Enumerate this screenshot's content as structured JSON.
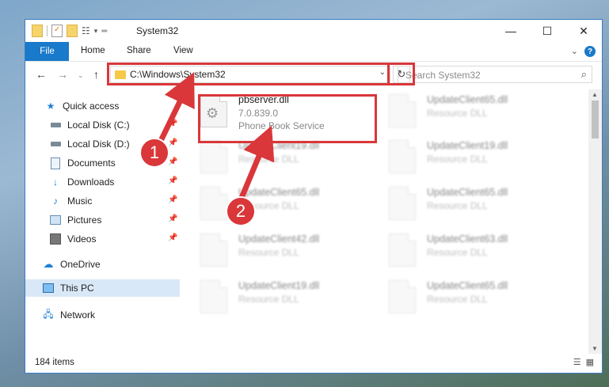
{
  "window": {
    "title": "System32"
  },
  "ribbon": {
    "file_label": "File",
    "tabs": [
      "Home",
      "Share",
      "View"
    ],
    "help_label": "?"
  },
  "address": {
    "path": "C:\\Windows\\System32"
  },
  "search": {
    "placeholder": "Search System32"
  },
  "sidebar": {
    "items": [
      {
        "label": "Quick access",
        "icon": "star-icon"
      },
      {
        "label": "Local Disk (C:)",
        "icon": "drive-icon"
      },
      {
        "label": "Local Disk (D:)",
        "icon": "drive-icon"
      },
      {
        "label": "Documents",
        "icon": "documents-icon"
      },
      {
        "label": "Downloads",
        "icon": "download-icon"
      },
      {
        "label": "Music",
        "icon": "music-icon"
      },
      {
        "label": "Pictures",
        "icon": "pictures-icon"
      },
      {
        "label": "Videos",
        "icon": "videos-icon"
      },
      {
        "label": "OneDrive",
        "icon": "cloud-icon"
      },
      {
        "label": "This PC",
        "icon": "computer-icon"
      },
      {
        "label": "Network",
        "icon": "network-icon"
      }
    ]
  },
  "files": {
    "highlighted": {
      "name": "pbserver.dll",
      "version": "7.0.839.0",
      "description": "Phone Book Service"
    },
    "col1": [
      {
        "name": "UpdateClient19.dll",
        "type": "Resource DLL"
      },
      {
        "name": "UpdateClient65.dll",
        "type": "Resource DLL"
      },
      {
        "name": "UpdateClient42.dll",
        "type": "Resource DLL"
      },
      {
        "name": "UpdateClient19.dll",
        "type": "Resource DLL"
      }
    ],
    "col2": [
      {
        "name": "UpdateClient65.dll",
        "type": "Resource DLL"
      },
      {
        "name": "UpdateClient19.dll",
        "type": "Resource DLL"
      },
      {
        "name": "UpdateClient65.dll",
        "type": "Resource DLL"
      },
      {
        "name": "UpdateClient63.dll",
        "type": "Resource DLL"
      },
      {
        "name": "UpdateClient65.dll",
        "type": "Resource DLL"
      }
    ]
  },
  "status": {
    "item_count": "184 items"
  },
  "annotations": {
    "step1": "1",
    "step2": "2",
    "color": "#d9373a"
  }
}
